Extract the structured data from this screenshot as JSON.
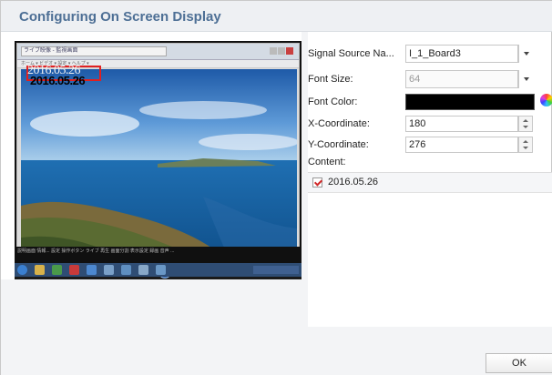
{
  "dialog": {
    "title": "Configuring On Screen Display"
  },
  "preview": {
    "browser_tab": "ライブ映像 - 監視画面",
    "browser_menu": "ホーム ▾ ビデオ ▾ 設定 ▾ ヘルプ ▾",
    "osd_text_overlay": "2016.05.26",
    "osd_text_rendered": "2016.05.26",
    "player_controls": "⊲ ▷ ◁◁ ▷▷ ⊃ ☾ ✕",
    "caption_strip": "説明画面  情報...  設定  操作ボタン  ライブ  再生  画面分割  表示設定  録画  音声  ..."
  },
  "form": {
    "signal_source": {
      "label": "Signal Source Na...",
      "value": "I_1_Board3"
    },
    "font_size": {
      "label": "Font Size:",
      "value": "64"
    },
    "font_color": {
      "label": "Font Color:",
      "value": "#000000"
    },
    "x_coordinate": {
      "label": "X-Coordinate:",
      "value": "180"
    },
    "y_coordinate": {
      "label": "Y-Coordinate:",
      "value": "276"
    },
    "content": {
      "label": "Content:",
      "items": [
        {
          "text": "2016.05.26",
          "checked": true
        }
      ]
    }
  },
  "footer": {
    "ok_label": "OK"
  },
  "colors": {
    "title": "#4d6f95",
    "checkmark": "#d02828",
    "osd_box": "#e02020"
  }
}
